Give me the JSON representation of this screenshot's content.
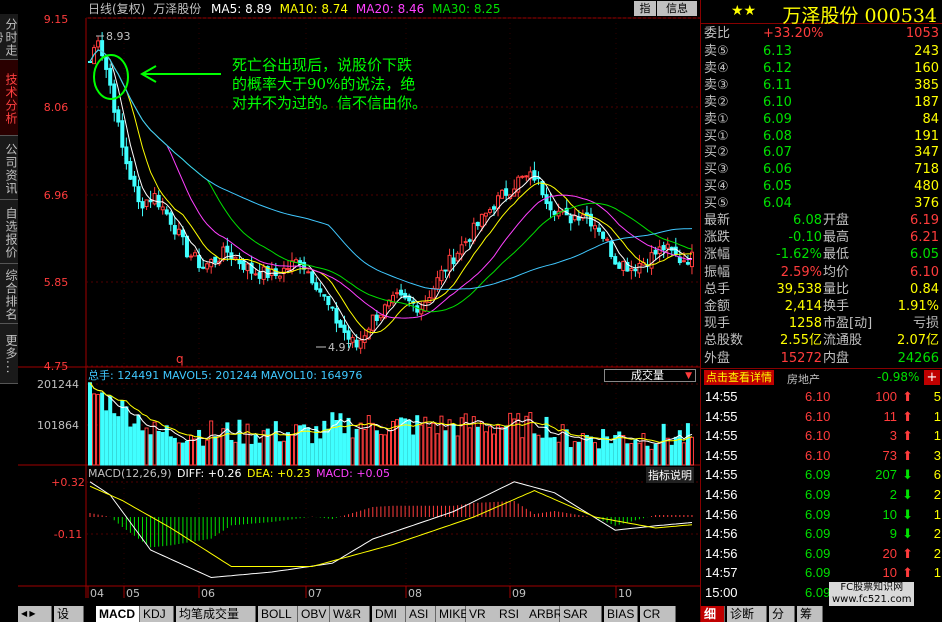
{
  "left_tabs": [
    "分时走势",
    "技术分析",
    "公司资讯",
    "自选报价",
    "综合排名",
    "更多..."
  ],
  "header": {
    "period": "日线(复权)",
    "name": "万泽股份",
    "ma5": "MA5: 8.89",
    "ma10": "MA10: 8.74",
    "ma20": "MA20: 8.46",
    "ma30": "MA30: 8.25",
    "btn_zhi": "指",
    "btn_info": "信息"
  },
  "price_axis": [
    "9.15",
    "8.06",
    "6.96",
    "5.85",
    "4.75"
  ],
  "annotations": {
    "high": "8.93",
    "low": "4.97",
    "q_mark": "q",
    "note_lines": [
      "死亡谷出现后，说股价下跌",
      "的概率大于90%的说法，绝",
      "对并不为过的。信不信由你。"
    ]
  },
  "volume": {
    "label": "总手: 124491  MAVOL5: 201244  MAVOL10: 164976",
    "selector": "成交量",
    "axis": [
      "201244",
      "101864"
    ]
  },
  "macd": {
    "title": "MACD(12,26,9)",
    "diff": "DIFF: +0.26",
    "dea": "DEA: +0.23",
    "macd": "MACD: +0.05",
    "help": "指标说明",
    "axis": [
      "+0.32",
      "-0.11"
    ]
  },
  "months": [
    "04",
    "05",
    "06",
    "07",
    "08",
    "09",
    "10"
  ],
  "bottom_tabs": [
    "设置",
    "MACD",
    "KDJ",
    "均笔成交量",
    "BOLL",
    "OBV",
    "W&R",
    "DMI",
    "ASI",
    "MIKE",
    "VR",
    "RSI",
    "ARBR",
    "SAR",
    "BIAS",
    "CR"
  ],
  "quote": {
    "stars": "★★",
    "title": "万泽股份 000534",
    "weibi_label": "委比",
    "weibi": "+33.20%",
    "weicha": "1053",
    "sell": [
      {
        "l": "卖⑤",
        "p": "6.13",
        "v": "243"
      },
      {
        "l": "卖④",
        "p": "6.12",
        "v": "160"
      },
      {
        "l": "卖③",
        "p": "6.11",
        "v": "385"
      },
      {
        "l": "卖②",
        "p": "6.10",
        "v": "187"
      },
      {
        "l": "卖①",
        "p": "6.09",
        "v": "84"
      }
    ],
    "buy": [
      {
        "l": "买①",
        "p": "6.08",
        "v": "191"
      },
      {
        "l": "买②",
        "p": "6.07",
        "v": "347"
      },
      {
        "l": "买③",
        "p": "6.06",
        "v": "718"
      },
      {
        "l": "买④",
        "p": "6.05",
        "v": "480"
      },
      {
        "l": "买⑤",
        "p": "6.04",
        "v": "376"
      }
    ],
    "stats": [
      {
        "a": "最新",
        "b": "6.08",
        "c": "开盘",
        "d": "6.19"
      },
      {
        "a": "涨跌",
        "b": "-0.10",
        "c": "最高",
        "d": "6.21"
      },
      {
        "a": "涨幅",
        "b": "-1.62%",
        "c": "最低",
        "d": "6.05"
      },
      {
        "a": "振幅",
        "b": "2.59%",
        "c": "均价",
        "d": "6.10"
      },
      {
        "a": "总手",
        "b": "39,538",
        "c": "量比",
        "d": "0.84"
      },
      {
        "a": "金额",
        "b": "2,414",
        "c": "换手",
        "d": "1.91%"
      },
      {
        "a": "现手",
        "b": "1258",
        "c": "市盈[动]",
        "d": "亏损"
      },
      {
        "a": "总股数",
        "b": "2.55亿",
        "c": "流通股",
        "d": "2.07亿"
      },
      {
        "a": "外盘",
        "b": "15272",
        "c": "内盘",
        "d": "24266"
      }
    ],
    "detail_btn": "点击查看详情",
    "sector": "房地产",
    "sector_chg": "-0.98%",
    "plus": "+",
    "ticks": [
      {
        "t": "14:55",
        "p": "6.10",
        "v": "100",
        "d": "up",
        "n": "5"
      },
      {
        "t": "14:55",
        "p": "6.10",
        "v": "11",
        "d": "up",
        "n": "1"
      },
      {
        "t": "14:55",
        "p": "6.10",
        "v": "3",
        "d": "up",
        "n": "1"
      },
      {
        "t": "14:55",
        "p": "6.10",
        "v": "73",
        "d": "up",
        "n": "3"
      },
      {
        "t": "14:55",
        "p": "6.09",
        "v": "207",
        "d": "dn",
        "n": "6"
      },
      {
        "t": "14:56",
        "p": "6.09",
        "v": "2",
        "d": "dn",
        "n": "2"
      },
      {
        "t": "14:56",
        "p": "6.09",
        "v": "10",
        "d": "dn",
        "n": "1"
      },
      {
        "t": "14:56",
        "p": "6.09",
        "v": "9",
        "d": "dn",
        "n": "2"
      },
      {
        "t": "14:56",
        "p": "6.09",
        "v": "20",
        "d": "up",
        "n": "2"
      },
      {
        "t": "14:57",
        "p": "6.09",
        "v": "10",
        "d": "up",
        "n": "1"
      },
      {
        "t": "15:00",
        "p": "6.09",
        "v": "",
        "d": "",
        "n": ""
      }
    ],
    "bottom_tabs": [
      "细",
      "诊断",
      "分",
      "筹"
    ],
    "watermark1": "FC股票知识网",
    "watermark2": "www.fc521.com"
  }
}
